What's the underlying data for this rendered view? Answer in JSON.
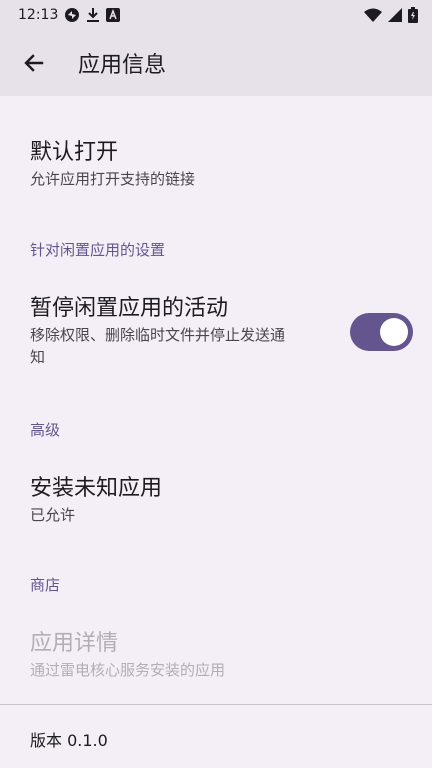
{
  "status_bar": {
    "time": "12:13",
    "icons_left": [
      "sync-icon",
      "download-icon",
      "a-badge-icon"
    ],
    "icons_right": [
      "wifi-icon",
      "signal-icon",
      "battery-icon"
    ]
  },
  "app_bar": {
    "title": "应用信息",
    "back_icon": "arrow-back-icon"
  },
  "items": {
    "default_open": {
      "title": "默认打开",
      "subtitle": "允许应用打开支持的链接"
    },
    "unused_section": "针对闲置应用的设置",
    "pause_activity": {
      "title": "暂停闲置应用的活动",
      "subtitle_line1": "移除权限、删除临时文件并停止发送通",
      "subtitle_line2": "知",
      "toggle_on": true
    },
    "advanced_section": "高级",
    "install_unknown": {
      "title": "安装未知应用",
      "subtitle": "已允许"
    },
    "store_section": "商店",
    "app_details": {
      "title": "应用详情",
      "subtitle": "通过雷电核心服务安装的应用"
    }
  },
  "version": "版本 0.1.0",
  "colors": {
    "accent": "#65558F",
    "background": "#F4EFF6",
    "app_bar": "#E7E1EA",
    "disabled_text": "#B2ADB6"
  }
}
